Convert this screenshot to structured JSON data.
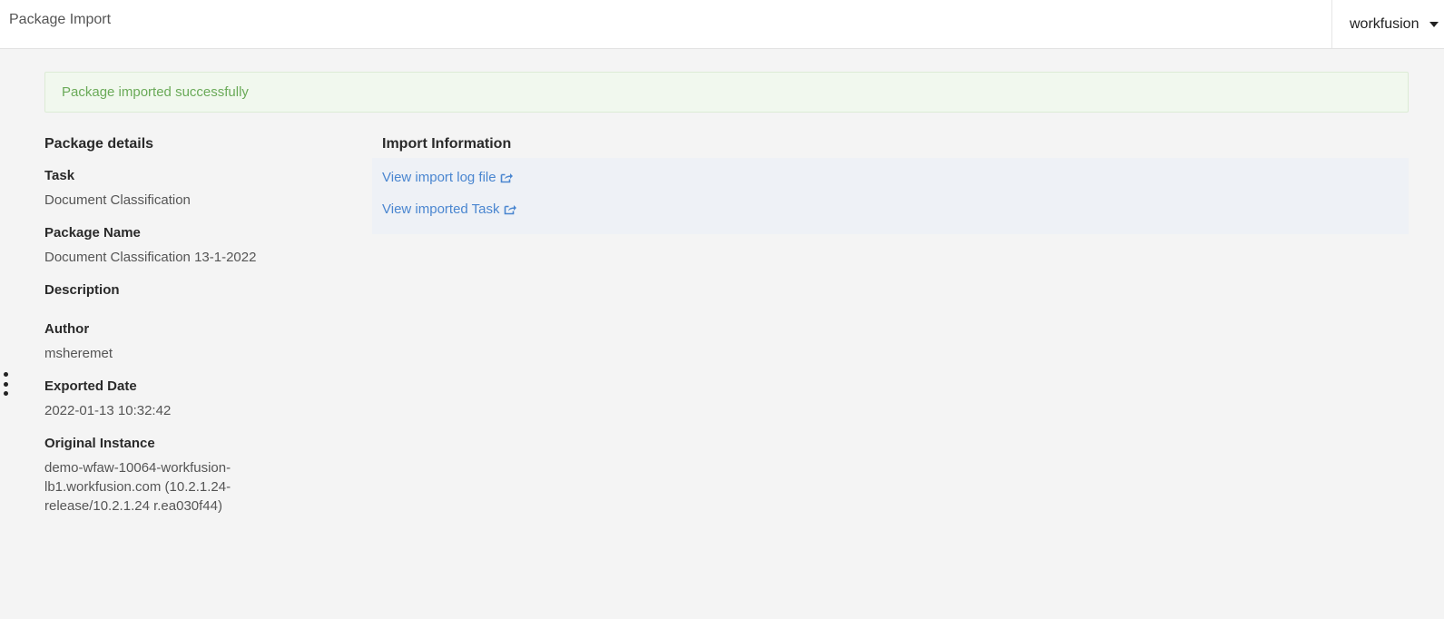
{
  "header": {
    "title": "Package Import",
    "user": "workfusion",
    "user_menu_icon": "caret-down-icon"
  },
  "alert": {
    "message": "Package imported successfully",
    "color": "#6aaa58"
  },
  "package_details": {
    "title": "Package details",
    "fields": [
      {
        "label": "Task",
        "value": "Document Classification"
      },
      {
        "label": "Package Name",
        "value": "Document Classification 13-1-2022"
      },
      {
        "label": "Description",
        "value": ""
      },
      {
        "label": "Author",
        "value": "msheremet"
      },
      {
        "label": "Exported Date",
        "value": "2022-01-13 10:32:42"
      },
      {
        "label": "Original Instance",
        "value": "demo-wfaw-10064-workfusion-lb1.workfusion.com (10.2.1.24-release/10.2.1.24 r.ea030f44)"
      }
    ]
  },
  "import_information": {
    "title": "Import Information",
    "links": [
      {
        "label": "View import log file",
        "icon": "external-link-icon"
      },
      {
        "label": "View imported Task",
        "icon": "external-link-icon"
      }
    ],
    "link_color": "#4a86d0"
  },
  "side_handle_icon": "vertical-ellipsis-icon"
}
